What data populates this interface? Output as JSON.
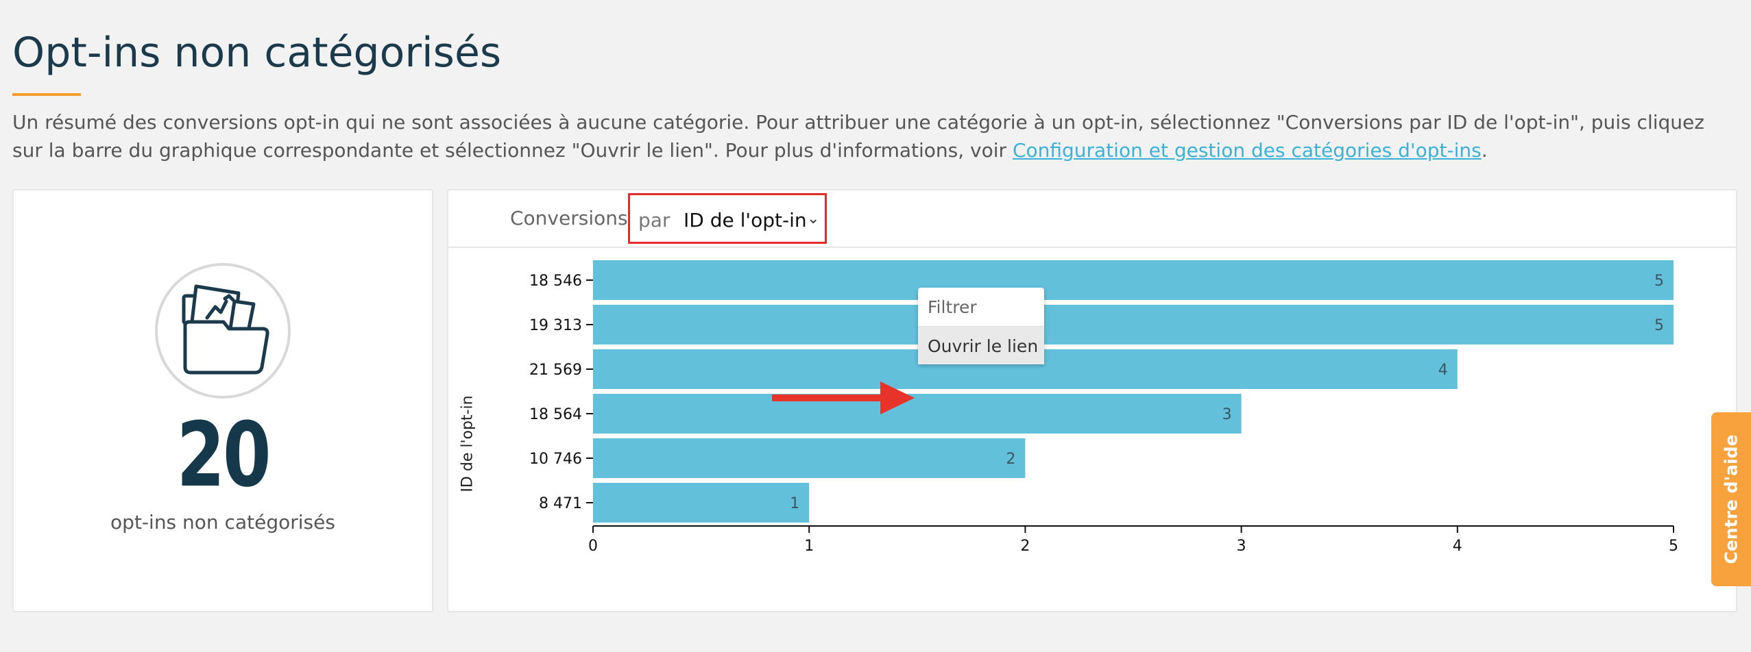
{
  "page": {
    "title": "Opt-ins non catégorisés",
    "description_text": "Un résumé des conversions opt-in qui ne sont associées à aucune catégorie. Pour attribuer une catégorie à un opt-in, sélectionnez \"Conversions par ID de l'opt-in\", puis cliquez sur la barre du graphique correspondante et sélectionnez \"Ouvrir le lien\". Pour plus d'informations, voir ",
    "description_link": "Configuration et gestion des catégories d'opt-ins",
    "description_end": "."
  },
  "summary": {
    "icon": "folder-icon",
    "count": "20",
    "label": "opt-ins non catégorisés"
  },
  "chart_panel": {
    "conversions_label": "Conversions",
    "par_label": "par",
    "selected_option": "ID de l'opt-in",
    "dropdown_icon": "chevron-down-icon"
  },
  "context_menu": {
    "items": [
      "Filtrer",
      "Ouvrir le lien"
    ]
  },
  "help_tab": {
    "label": "Centre d'aide"
  },
  "colors": {
    "bar": "#62c0db",
    "accent": "#f39c2b",
    "highlight_box": "#e52b2b",
    "arrow": "#e8332a",
    "title": "#1b3a4b"
  },
  "chart_data": {
    "type": "bar",
    "orientation": "horizontal",
    "categories": [
      "18 546",
      "19 313",
      "21 569",
      "18 564",
      "10 746",
      "8 471"
    ],
    "values": [
      5,
      5,
      4,
      3,
      2,
      1
    ],
    "ylabel": "ID de l'opt-in",
    "xlabel": "",
    "xlim": [
      0,
      5
    ],
    "xticks": [
      0,
      1,
      2,
      3,
      4,
      5
    ],
    "grid": false
  }
}
